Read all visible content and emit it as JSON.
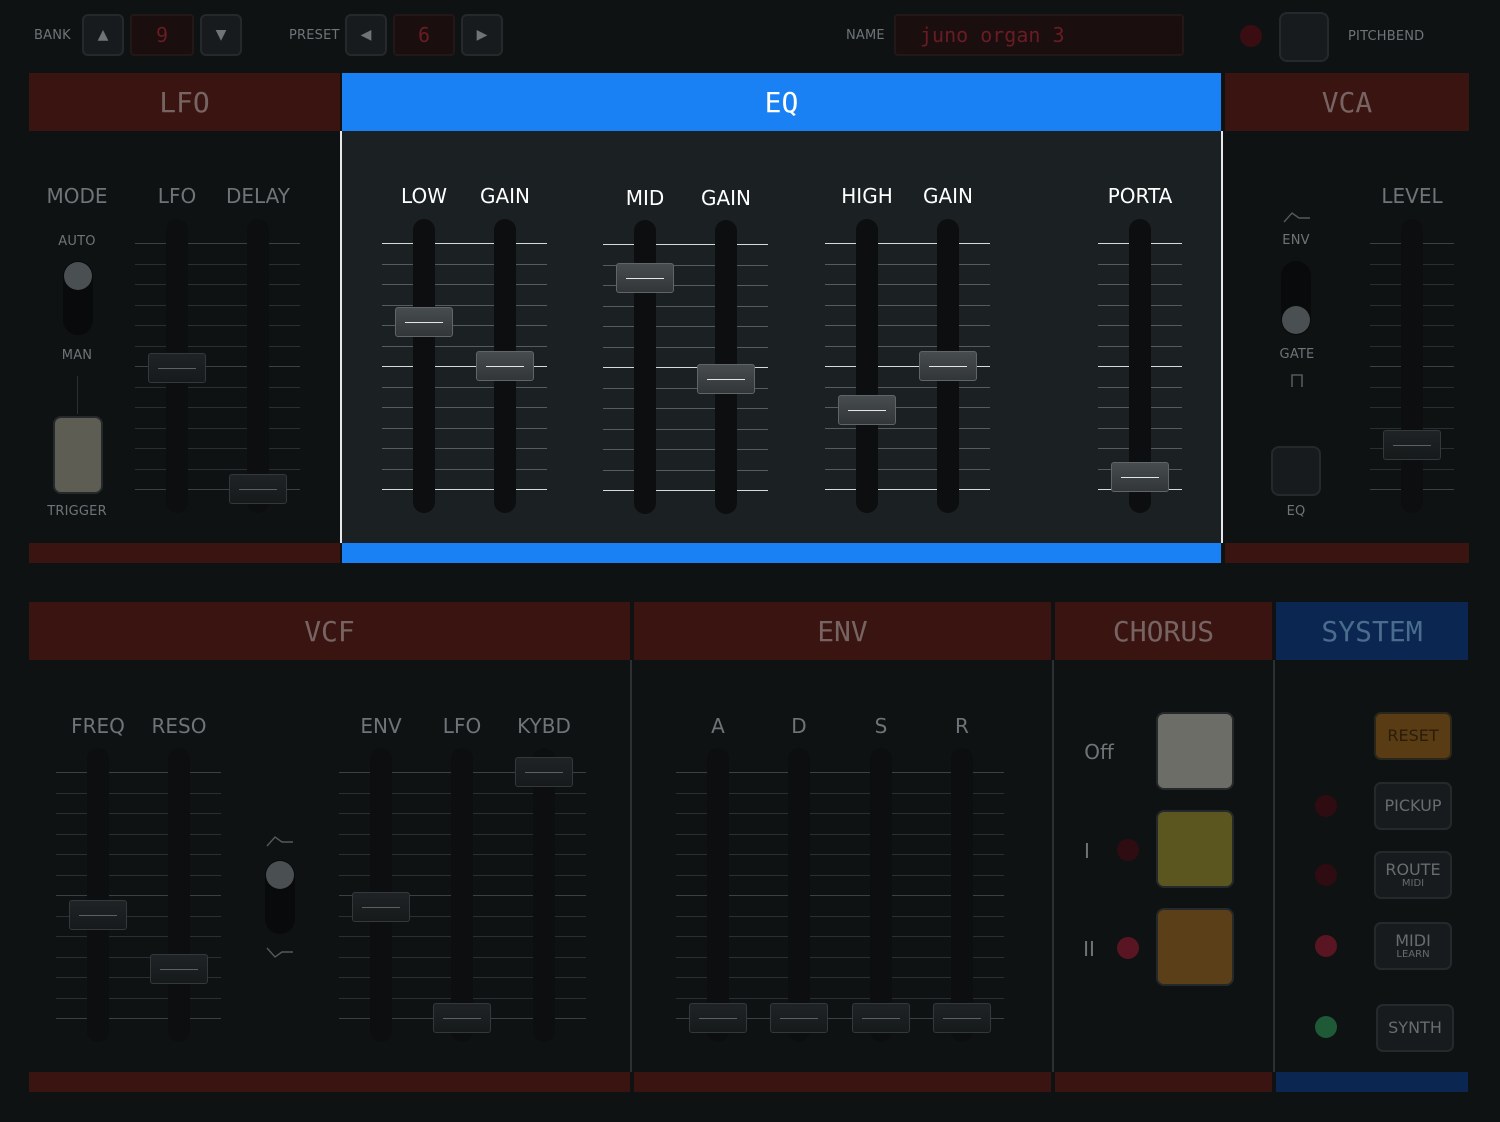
{
  "top": {
    "bank_label": "BANK",
    "bank_value": "9",
    "preset_label": "PRESET",
    "preset_value": "6",
    "name_label": "NAME",
    "name_value": "juno organ 3",
    "pitchbend_label": "PITCHBEND",
    "up_icon": "▲",
    "down_icon": "▼",
    "left_icon": "◀",
    "right_icon": "▶"
  },
  "lfo": {
    "title": "LFO",
    "mode_label": "MODE",
    "auto_label": "AUTO",
    "man_label": "MAN",
    "trigger_label": "TRIGGER",
    "rate_label": "LFO",
    "delay_label": "DELAY",
    "rate_value": 0.49,
    "delay_value": 0.0
  },
  "eq": {
    "title": "EQ",
    "low_label": "LOW",
    "low_gain_label": "GAIN",
    "mid_label": "MID",
    "mid_gain_label": "GAIN",
    "high_label": "HIGH",
    "high_gain_label": "GAIN",
    "porta_label": "PORTA",
    "low_value": 0.68,
    "low_gain_value": 0.5,
    "mid_value": 0.86,
    "mid_gain_value": 0.45,
    "high_value": 0.32,
    "high_gain_value": 0.5,
    "porta_value": 0.05
  },
  "vca": {
    "title": "VCA",
    "env_label": "ENV",
    "gate_label": "GATE",
    "eq_label": "EQ",
    "level_label": "LEVEL",
    "level_value": 0.18
  },
  "vcf": {
    "title": "VCF",
    "freq_label": "FREQ",
    "reso_label": "RESO",
    "env_label": "ENV",
    "lfo_label": "LFO",
    "kybd_label": "KYBD",
    "freq_value": 0.42,
    "reso_value": 0.2,
    "env_value": 0.45,
    "lfo_value": 0.0,
    "kybd_value": 1.0
  },
  "env": {
    "title": "ENV",
    "a_label": "A",
    "d_label": "D",
    "s_label": "S",
    "r_label": "R",
    "a_value": 0.0,
    "d_value": 0.0,
    "s_value": 0.0,
    "r_value": 0.0
  },
  "chorus": {
    "title": "CHORUS",
    "off_label": "Off",
    "one_label": "I",
    "two_label": "II",
    "off_color": "#6c6d67",
    "one_color": "#5b5620",
    "two_color": "#5a3f18"
  },
  "system": {
    "title": "SYSTEM",
    "reset_label": "RESET",
    "pickup_label": "PICKUP",
    "route_label": "ROUTE",
    "route_sub": "MIDI",
    "midi_label": "MIDI",
    "midi_sub": "LEARN",
    "synth_label": "SYNTH"
  },
  "colors": {
    "accent": "#1a81f4",
    "section_header": "#391410",
    "system_header": "#0c2652",
    "led_off": "#3a0d12",
    "led_red": "#5a1523",
    "led_green": "#1e5a36",
    "reset": "#5a3c14"
  }
}
